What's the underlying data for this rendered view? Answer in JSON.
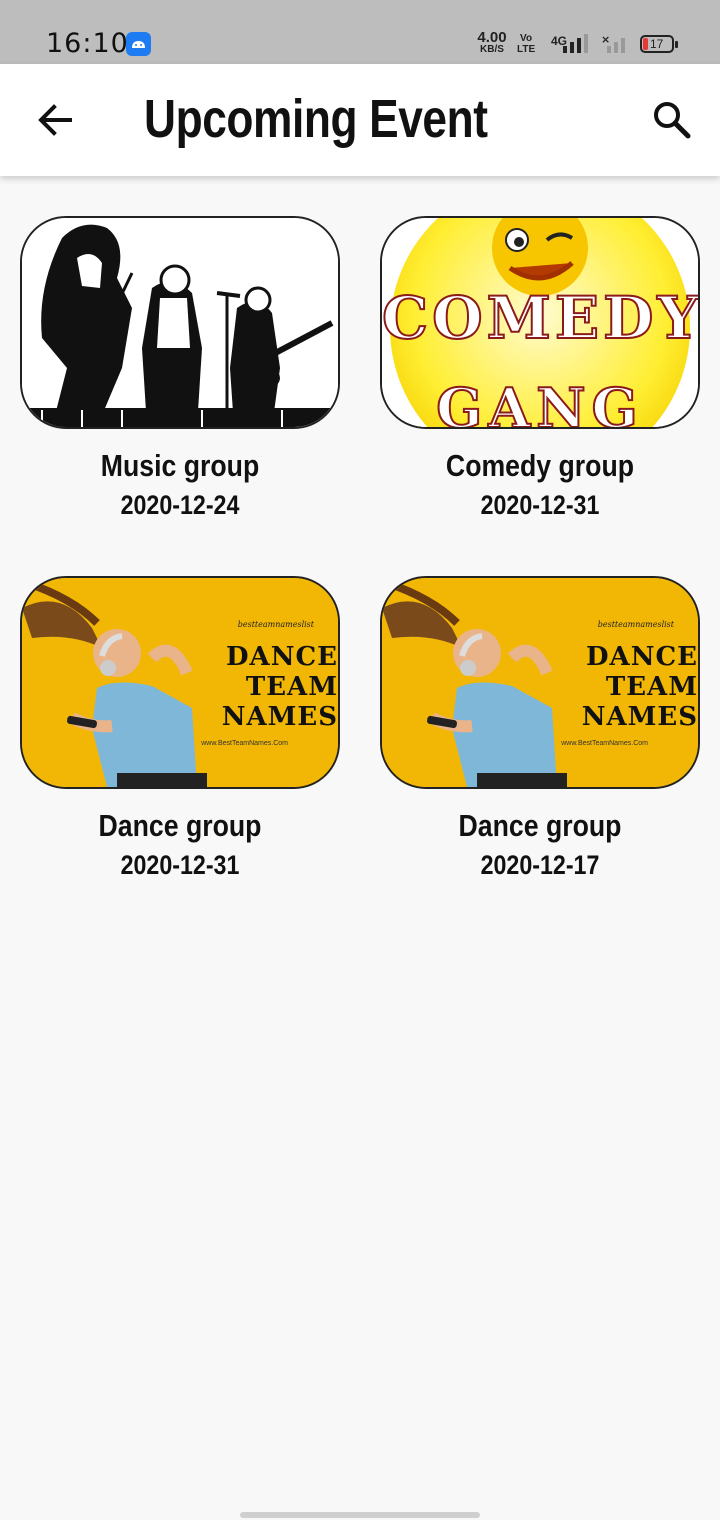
{
  "status_bar": {
    "time": "16:10",
    "net_speed_value": "4.00",
    "net_speed_unit": "KB/S",
    "volte_top": "Vo",
    "volte_bottom": "LTE",
    "network": "4G",
    "battery": "17",
    "icons": [
      "android-app-icon",
      "signal-icon",
      "no-signal-icon",
      "battery-icon"
    ]
  },
  "app_bar": {
    "title": "Upcoming Event",
    "back_icon": "arrow-back-icon",
    "search_icon": "search-icon"
  },
  "events": [
    {
      "name": "Music group",
      "date": "2020-12-24",
      "image": "band-illustration"
    },
    {
      "name": "Comedy group",
      "date": "2020-12-31",
      "image": "comedy-gang-banner",
      "image_text": [
        "COMEDY",
        "GANG"
      ]
    },
    {
      "name": "Dance group",
      "date": "2020-12-31",
      "image": "dance-team-names-banner",
      "image_text": {
        "small": "bestteamnameslist",
        "big": [
          "DANCE",
          "TEAM",
          "NAMES"
        ],
        "url": "www.BestTeamNames.Com"
      }
    },
    {
      "name": "Dance group",
      "date": "2020-12-17",
      "image": "dance-team-names-banner",
      "image_text": {
        "small": "bestteamnameslist",
        "big": [
          "DANCE",
          "TEAM",
          "NAMES"
        ],
        "url": "www.BestTeamNames.Com"
      }
    }
  ],
  "colors": {
    "status_bar": "#bdbdbd",
    "app_bar": "#ffffff",
    "background": "#f8f8f8",
    "dance_banner": "#f2b705",
    "comedy_yellow": "#ffee33",
    "comedy_red": "#8b1a1a"
  }
}
